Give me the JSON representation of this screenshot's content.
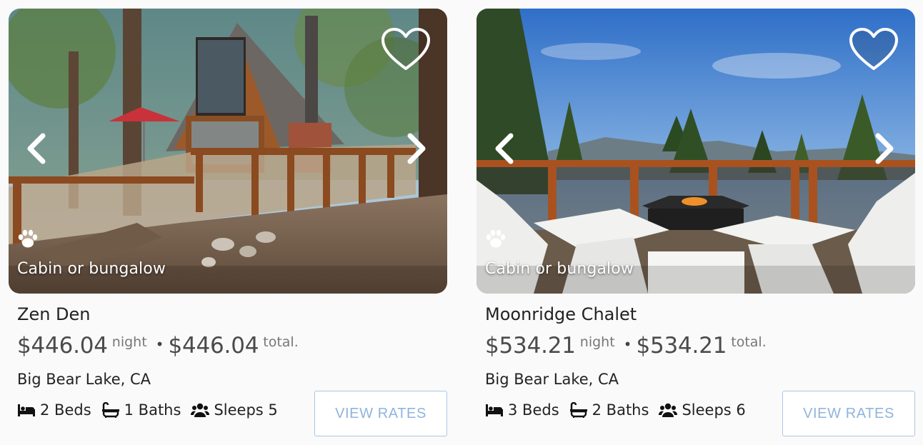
{
  "listings": [
    {
      "property_type": "Cabin or bungalow",
      "name": "Zen Den",
      "nightly_price": "$446.04",
      "night_label": "night",
      "separator": "•",
      "total_price": "$446.04",
      "total_label": "total.",
      "location": "Big Bear Lake, CA",
      "beds": "2 Beds",
      "baths": "1 Baths",
      "sleeps": "Sleeps 5",
      "button_label": "VIEW RATES",
      "favorited": false
    },
    {
      "property_type": "Cabin or bungalow",
      "name": "Moonridge Chalet",
      "nightly_price": "$534.21",
      "night_label": "night",
      "separator": "•",
      "total_price": "$534.21",
      "total_label": "total.",
      "location": "Big Bear Lake, CA",
      "beds": "3 Beds",
      "baths": "2 Baths",
      "sleeps": "Sleeps 6",
      "button_label": "VIEW RATES",
      "favorited": false
    }
  ],
  "icons": {
    "favorite": "heart-outline-icon",
    "prev": "chevron-left-icon",
    "next": "chevron-right-icon",
    "pet": "paw-icon",
    "bed": "bed-icon",
    "bath": "bathtub-icon",
    "sleeps": "users-icon"
  },
  "colors": {
    "button_text": "#8fb4dd",
    "button_border": "#aac7e6",
    "text": "#222222",
    "price_text": "#4b4b4b"
  }
}
